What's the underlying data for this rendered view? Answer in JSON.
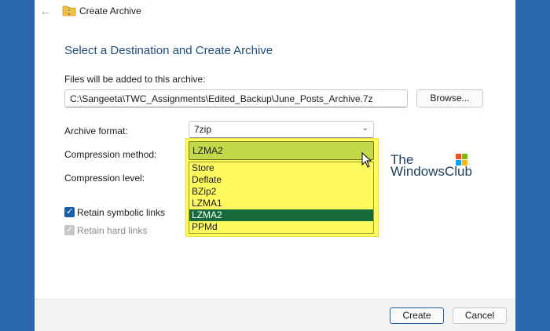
{
  "window": {
    "title": "Create Archive",
    "back_icon": "back-arrow-icon",
    "title_icon": "folder-zip-icon"
  },
  "heading": "Select a Destination and Create Archive",
  "files": {
    "label": "Files will be added to this archive:",
    "path_value": "C:\\Sangeeta\\TWC_Assignments\\Edited_Backup\\June_Posts_Archive.7z",
    "browse_label": "Browse..."
  },
  "archive_format": {
    "label": "Archive format:",
    "value": "7zip"
  },
  "compression_method": {
    "label": "Compression method:",
    "value": "LZMA2",
    "options": [
      "Store",
      "Deflate",
      "BZip2",
      "LZMA1",
      "LZMA2",
      "PPMd"
    ],
    "selected_index": 4
  },
  "compression_level": {
    "label": "Compression level:"
  },
  "options": {
    "symbolic_links": {
      "label": "Retain symbolic links",
      "checked": true
    },
    "hard_links": {
      "label": "Retain hard links",
      "checked": true,
      "disabled": true
    }
  },
  "watermark": {
    "line1": "The",
    "line2": "WindowsClub"
  },
  "footer": {
    "create_label": "Create",
    "cancel_label": "Cancel"
  },
  "colors": {
    "background": "#2b67ad",
    "heading": "#1f4e7a",
    "highlight": "#fffb5e",
    "selected_option": "#176b3a",
    "accent": "#1b5fa8"
  }
}
